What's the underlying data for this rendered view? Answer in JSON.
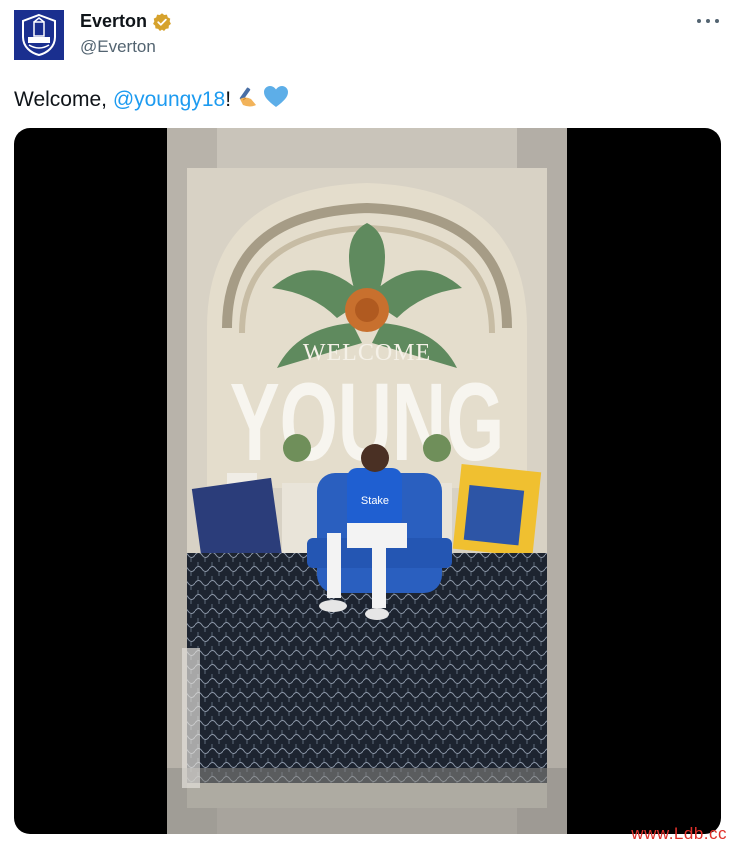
{
  "account": {
    "display_name": "Everton",
    "handle": "@Everton",
    "avatar_icon": "everton-crest-icon",
    "verified_icon": "verified-badge-icon",
    "verified_color": "#d6a22c",
    "avatar_color": "#1a2f8f"
  },
  "menu": {
    "more_icon": "more-options-icon"
  },
  "tweet": {
    "text_before": "Welcome, ",
    "mention": "@youngy18",
    "text_after": "!",
    "emojis": [
      "writing-hand-emoji",
      "blue-heart-emoji"
    ]
  },
  "media": {
    "type": "video",
    "poster_heading": "WELCOME",
    "poster_name": "YOUNG",
    "shirt_text": "Stake"
  },
  "watermark": "www.Ldb.cc",
  "colors": {
    "link": "#1d9bf0",
    "muted": "#536471",
    "watermark": "#e0302a"
  }
}
